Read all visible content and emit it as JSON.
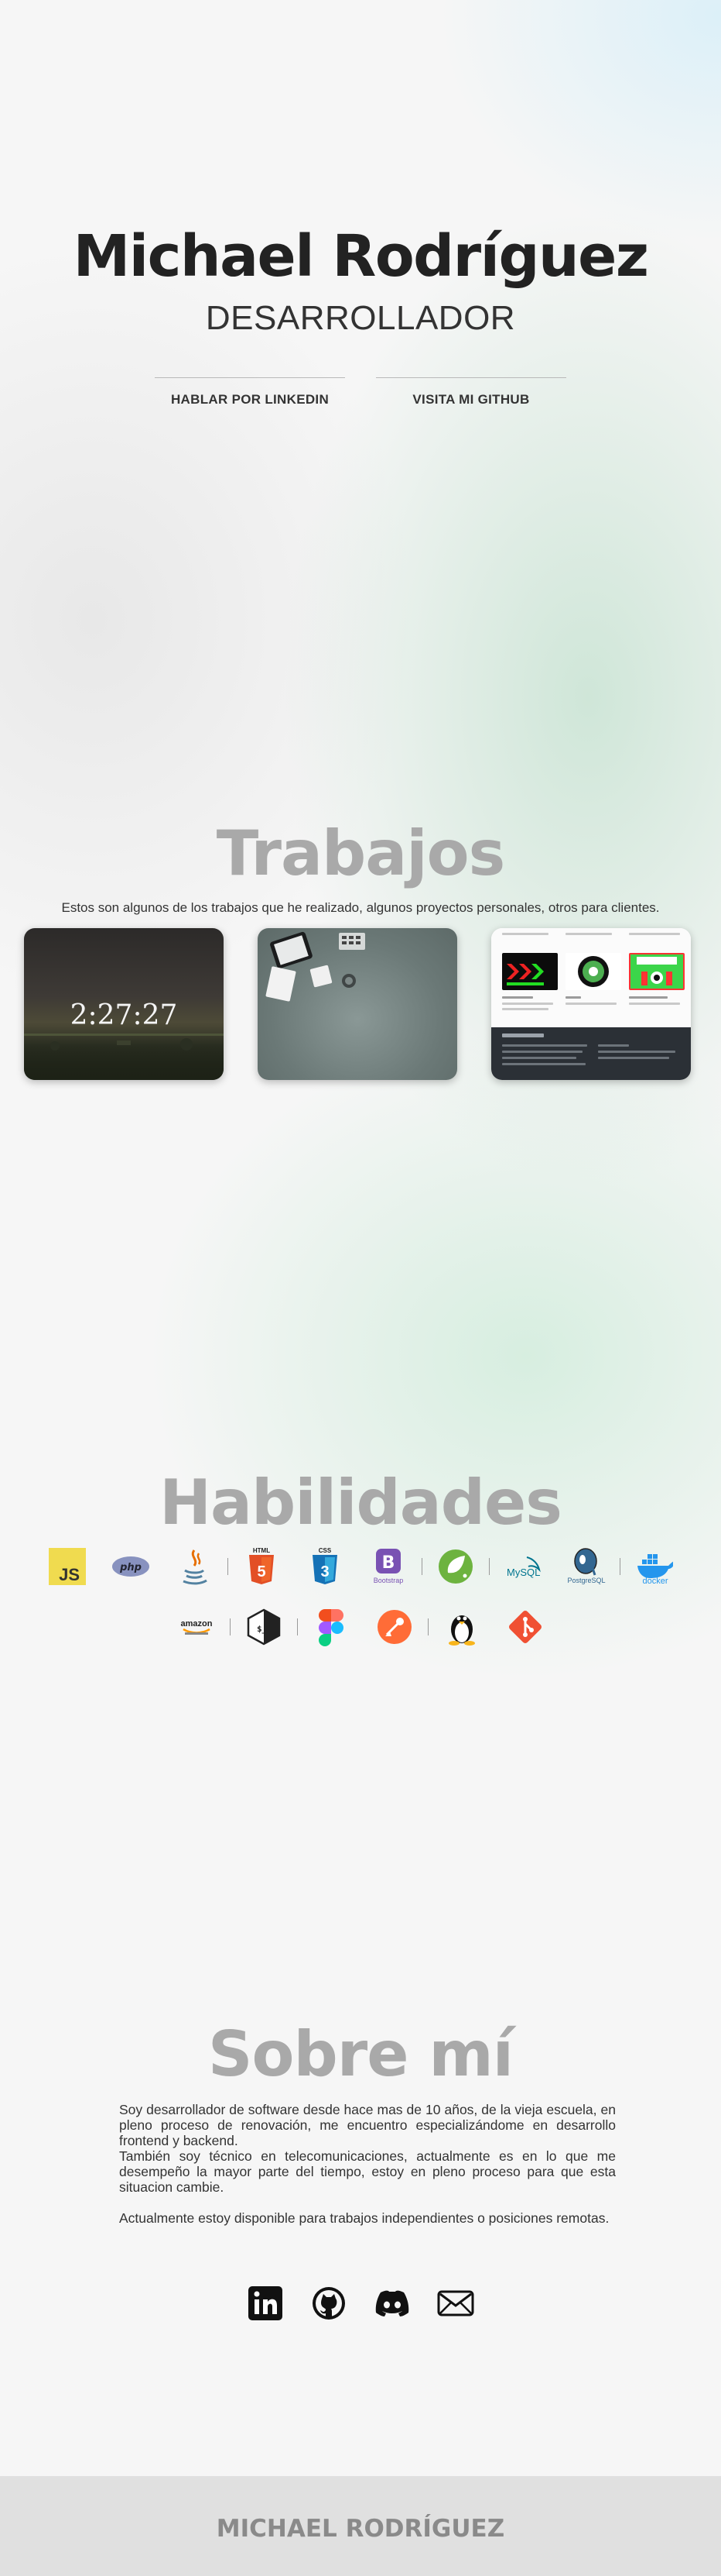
{
  "hero": {
    "name": "Michael Rodríguez",
    "role": "DESARROLLADOR",
    "links": [
      {
        "label": "HABLAR POR LINKEDIN"
      },
      {
        "label": "VISITA MI GITHUB"
      }
    ]
  },
  "works": {
    "title": "Trabajos",
    "description": "Estos son algunos de los trabajos que he realizado, algunos proyectos personales, otros para clientes.",
    "cards": [
      {
        "clock_text": "2:27:27"
      },
      {},
      {}
    ]
  },
  "skills": {
    "title": "Habilidades",
    "row1": [
      "javascript-icon",
      "php-icon",
      "java-icon",
      "html5-icon",
      "css3-icon",
      "bootstrap-icon",
      "spring-icon",
      "mysql-icon",
      "postgresql-icon",
      "docker-icon"
    ],
    "row2": [
      "aws-icon",
      "bash-icon",
      "figma-icon",
      "postman-icon",
      "linux-icon",
      "git-icon"
    ],
    "labels": {
      "js": "JS",
      "php": "php",
      "html": "HTML",
      "css": "CSS",
      "bootstrap_mark": "B",
      "bootstrap": "Bootstrap",
      "mysql": "MySQL",
      "postgres": "PostgreSQL",
      "docker": "docker",
      "amazon": "amazon",
      "bash": "$_"
    }
  },
  "about": {
    "title": "Sobre mí",
    "paragraph1": "Soy desarrollador de software desde hace mas de 10 años, de la vieja escuela, en pleno proceso de renovación, me encuentro especializándome en desarrollo frontend y backend.",
    "paragraph2": "También soy técnico en telecomunicaciones, actualmente es en lo que me desempeño la mayor parte del tiempo, estoy en pleno proceso para que esta situacion cambie.",
    "paragraph3": "Actualmente estoy disponible para trabajos independientes o posiciones remotas.",
    "socials": [
      "linkedin-icon",
      "github-icon",
      "discord-icon",
      "mail-icon"
    ]
  },
  "footer": {
    "name": "MICHAEL RODRÍGUEZ"
  },
  "colors": {
    "title_gray": "#a9a9a9",
    "text_dark": "#222222",
    "footer_bg": "#e0e0e0"
  }
}
